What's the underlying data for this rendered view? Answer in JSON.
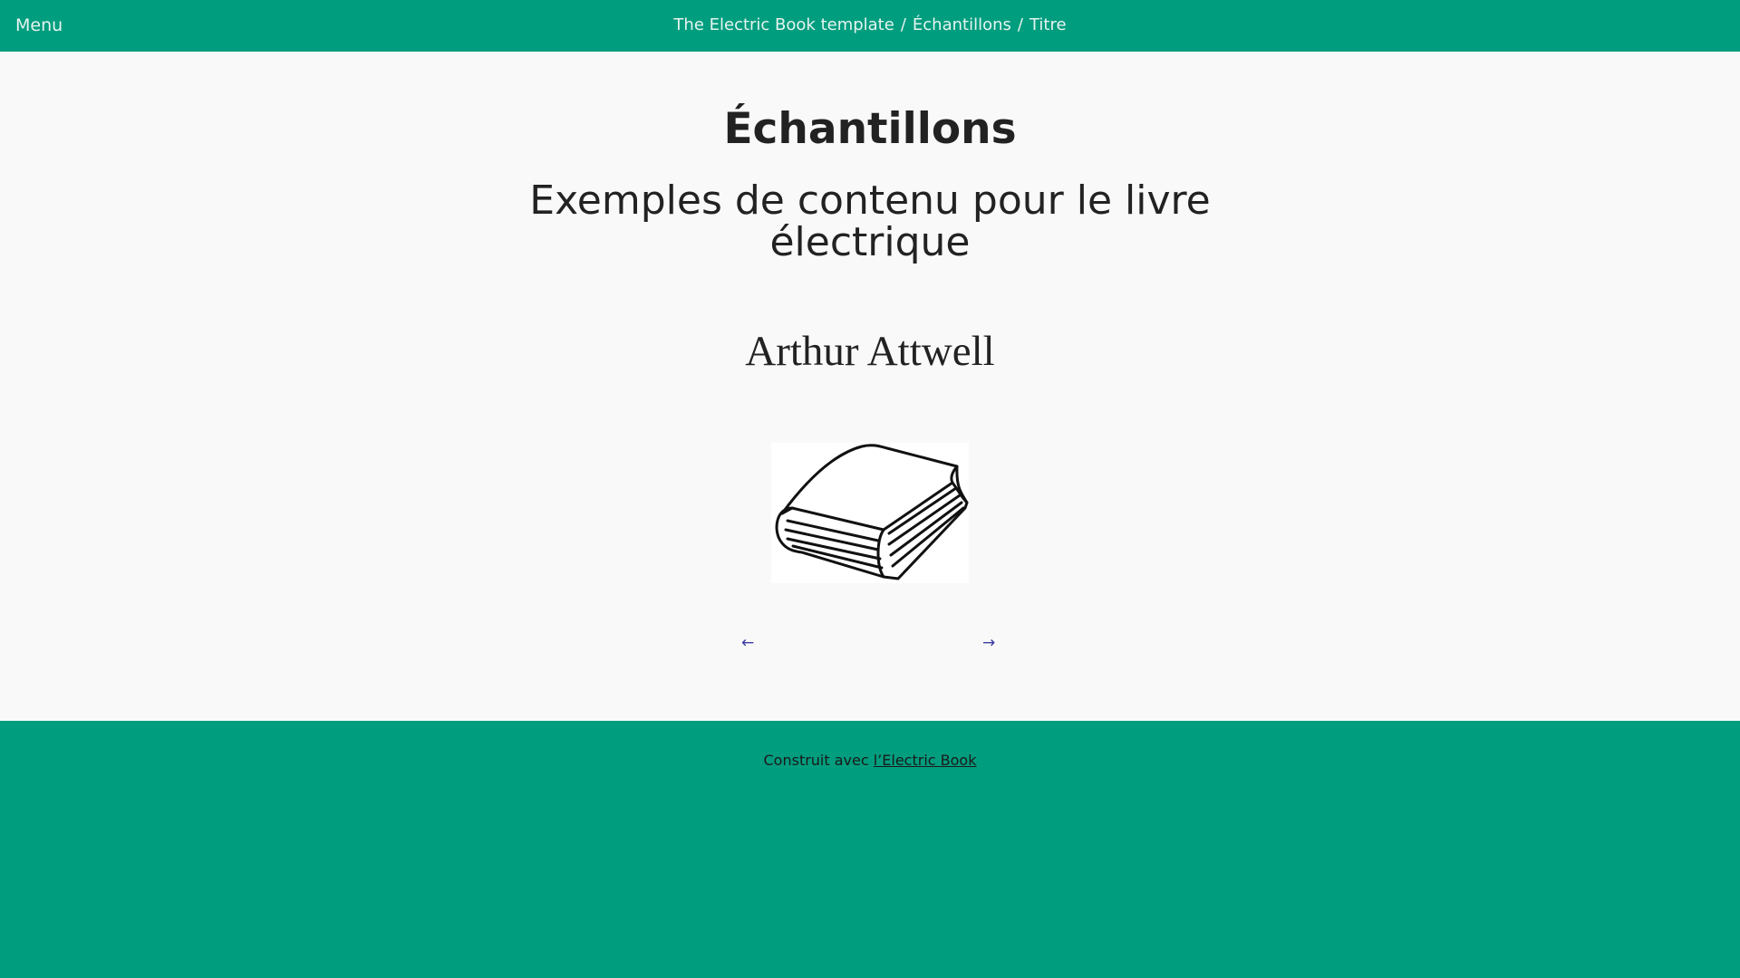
{
  "header": {
    "menu_label": "Menu",
    "breadcrumb": {
      "book": "The Electric Book template",
      "section": "Échantillons",
      "page": "Titre",
      "separator": "/"
    }
  },
  "content": {
    "title": "Échantillons",
    "subtitle": "Exemples de contenu pour le livre électrique",
    "author": "Arthur Attwell",
    "cover_image": "book-illustration"
  },
  "navigation": {
    "prev_label": "←",
    "next_label": "→"
  },
  "footer": {
    "text": "Construit avec",
    "link_label": "l’Electric Book"
  },
  "colors": {
    "brand": "#009d7e",
    "background": "#f9f9f9",
    "text": "#222222",
    "nav_link": "#3a3aa0"
  }
}
